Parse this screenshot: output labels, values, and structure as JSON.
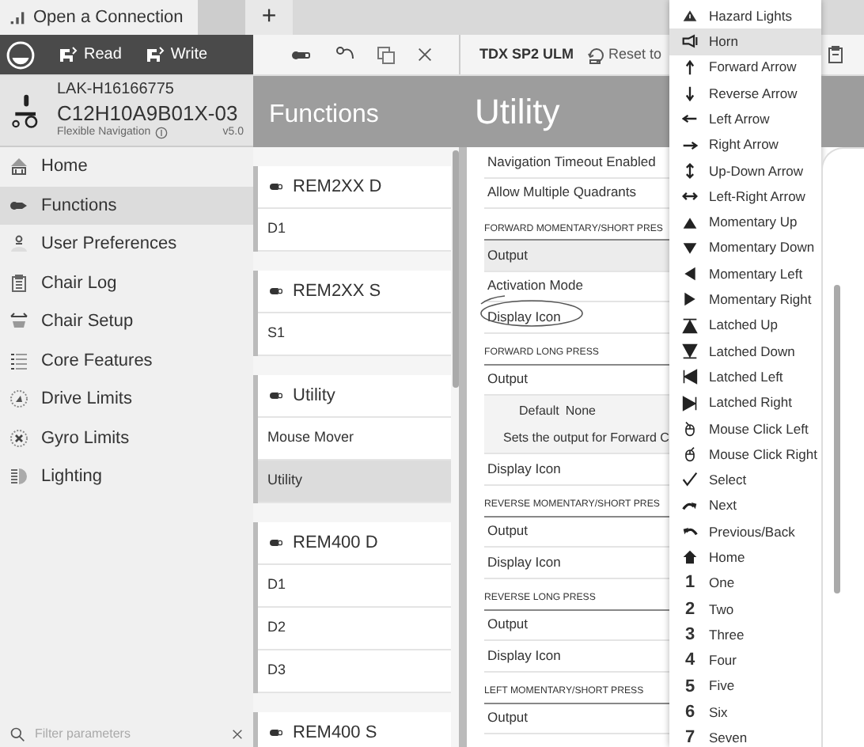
{
  "tabs": [
    {
      "label": "Open a Connection",
      "selected": true
    }
  ],
  "new_tab": "+",
  "toolbar": {
    "read": "Read",
    "write": "Write",
    "device_name": "TDX SP2 ULM",
    "reset": "Reset to"
  },
  "device": {
    "id": "LAK-H16166775",
    "serial": "C12H10A9B01X-03",
    "mode": "Flexible Navigation",
    "version": "v5.0"
  },
  "sidebar": {
    "items": [
      {
        "label": "Home",
        "selected": false
      },
      {
        "label": "Functions",
        "selected": true
      },
      {
        "label": "User Preferences",
        "selected": false
      },
      {
        "label": "Chair Log",
        "selected": false
      },
      {
        "label": "Chair Setup",
        "selected": false
      },
      {
        "label": "Core Features",
        "selected": false
      },
      {
        "label": "Drive Limits",
        "selected": false
      },
      {
        "label": "Gyro Limits",
        "selected": false
      },
      {
        "label": "Lighting",
        "selected": false
      }
    ],
    "filter": {
      "placeholder": "Filter parameters"
    }
  },
  "functions_panel": {
    "title": "Functions",
    "groups": [
      {
        "name": "REM2XX D",
        "items": [
          {
            "label": "D1",
            "selected": false
          }
        ]
      },
      {
        "name": "REM2XX S",
        "items": [
          {
            "label": "S1",
            "selected": false
          }
        ]
      },
      {
        "name": "Utility",
        "items": [
          {
            "label": "Mouse Mover",
            "selected": false
          },
          {
            "label": "Utility",
            "selected": true
          }
        ]
      },
      {
        "name": "REM400 D",
        "items": [
          {
            "label": "D1",
            "selected": false
          },
          {
            "label": "D2",
            "selected": false
          },
          {
            "label": "D3",
            "selected": false
          }
        ]
      },
      {
        "name": "REM400 S"
      }
    ]
  },
  "utility_panel": {
    "title": "Utility",
    "rows": [
      {
        "kind": "row",
        "label": "Navigation Timeout Enabled",
        "highlighted": false
      },
      {
        "kind": "row",
        "label": "Allow Multiple Quadrants",
        "highlighted": false
      },
      {
        "kind": "section",
        "label": "FORWARD MOMENTARY/SHORT PRES"
      },
      {
        "kind": "row",
        "label": "Output",
        "highlighted": true
      },
      {
        "kind": "row",
        "label": "Activation Mode",
        "highlighted": false
      },
      {
        "kind": "row",
        "label": "Display Icon",
        "highlighted": false,
        "circled": true
      },
      {
        "kind": "section",
        "label": "FORWARD LONG PRESS"
      },
      {
        "kind": "row",
        "label": "Output",
        "highlighted": false
      },
      {
        "kind": "info",
        "default_label": "Default",
        "default_value": "None",
        "description": "Sets the output for Forward C"
      },
      {
        "kind": "row",
        "label": "Display Icon",
        "highlighted": false
      },
      {
        "kind": "section",
        "label": "REVERSE MOMENTARY/SHORT PRES"
      },
      {
        "kind": "row",
        "label": "Output",
        "highlighted": false
      },
      {
        "kind": "row",
        "label": "Display Icon",
        "highlighted": false
      },
      {
        "kind": "section",
        "label": "REVERSE LONG PRESS"
      },
      {
        "kind": "row",
        "label": "Output",
        "highlighted": false
      },
      {
        "kind": "row",
        "label": "Display Icon",
        "highlighted": false
      },
      {
        "kind": "section",
        "label": "LEFT MOMENTARY/SHORT PRESS"
      },
      {
        "kind": "row",
        "label": "Output",
        "highlighted": false
      }
    ]
  },
  "dropdown": {
    "options": [
      {
        "label": "Hazard Lights",
        "selected": false
      },
      {
        "label": "Horn",
        "selected": true
      },
      {
        "label": "Forward Arrow",
        "selected": false
      },
      {
        "label": "Reverse Arrow",
        "selected": false
      },
      {
        "label": "Left Arrow",
        "selected": false
      },
      {
        "label": "Right Arrow",
        "selected": false
      },
      {
        "label": "Up-Down Arrow",
        "selected": false
      },
      {
        "label": "Left-Right Arrow",
        "selected": false
      },
      {
        "label": "Momentary Up",
        "selected": false
      },
      {
        "label": "Momentary Down",
        "selected": false
      },
      {
        "label": "Momentary Left",
        "selected": false
      },
      {
        "label": "Momentary Right",
        "selected": false
      },
      {
        "label": "Latched Up",
        "selected": false
      },
      {
        "label": "Latched Down",
        "selected": false
      },
      {
        "label": "Latched Left",
        "selected": false
      },
      {
        "label": "Latched Right",
        "selected": false
      },
      {
        "label": "Mouse Click Left",
        "selected": false
      },
      {
        "label": "Mouse Click Right",
        "selected": false
      },
      {
        "label": "Select",
        "selected": false
      },
      {
        "label": "Next",
        "selected": false
      },
      {
        "label": "Previous/Back",
        "selected": false
      },
      {
        "label": "Home",
        "selected": false
      },
      {
        "label": "One",
        "selected": false,
        "glyph": "1"
      },
      {
        "label": "Two",
        "selected": false,
        "glyph": "2"
      },
      {
        "label": "Three",
        "selected": false,
        "glyph": "3"
      },
      {
        "label": "Four",
        "selected": false,
        "glyph": "4"
      },
      {
        "label": "Five",
        "selected": false,
        "glyph": "5"
      },
      {
        "label": "Six",
        "selected": false,
        "glyph": "6"
      },
      {
        "label": "Seven",
        "selected": false,
        "glyph": "7"
      }
    ]
  }
}
